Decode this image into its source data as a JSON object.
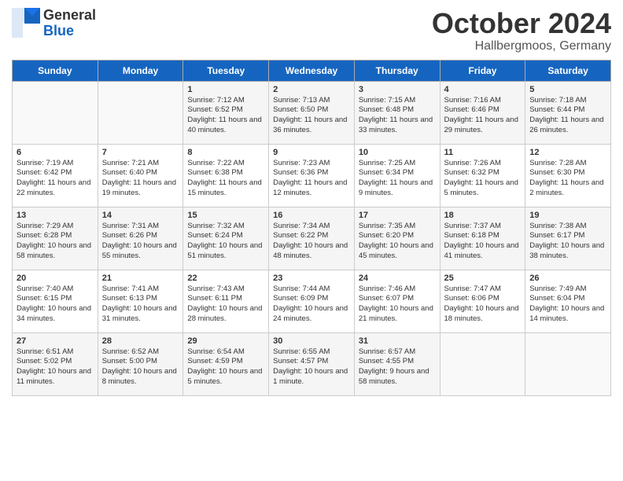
{
  "header": {
    "logo_general": "General",
    "logo_blue": "Blue",
    "month_title": "October 2024",
    "location": "Hallbergmoos, Germany"
  },
  "days_of_week": [
    "Sunday",
    "Monday",
    "Tuesday",
    "Wednesday",
    "Thursday",
    "Friday",
    "Saturday"
  ],
  "weeks": [
    [
      {
        "day": "",
        "info": ""
      },
      {
        "day": "",
        "info": ""
      },
      {
        "day": "1",
        "info": "Sunrise: 7:12 AM\nSunset: 6:52 PM\nDaylight: 11 hours and 40 minutes."
      },
      {
        "day": "2",
        "info": "Sunrise: 7:13 AM\nSunset: 6:50 PM\nDaylight: 11 hours and 36 minutes."
      },
      {
        "day": "3",
        "info": "Sunrise: 7:15 AM\nSunset: 6:48 PM\nDaylight: 11 hours and 33 minutes."
      },
      {
        "day": "4",
        "info": "Sunrise: 7:16 AM\nSunset: 6:46 PM\nDaylight: 11 hours and 29 minutes."
      },
      {
        "day": "5",
        "info": "Sunrise: 7:18 AM\nSunset: 6:44 PM\nDaylight: 11 hours and 26 minutes."
      }
    ],
    [
      {
        "day": "6",
        "info": "Sunrise: 7:19 AM\nSunset: 6:42 PM\nDaylight: 11 hours and 22 minutes."
      },
      {
        "day": "7",
        "info": "Sunrise: 7:21 AM\nSunset: 6:40 PM\nDaylight: 11 hours and 19 minutes."
      },
      {
        "day": "8",
        "info": "Sunrise: 7:22 AM\nSunset: 6:38 PM\nDaylight: 11 hours and 15 minutes."
      },
      {
        "day": "9",
        "info": "Sunrise: 7:23 AM\nSunset: 6:36 PM\nDaylight: 11 hours and 12 minutes."
      },
      {
        "day": "10",
        "info": "Sunrise: 7:25 AM\nSunset: 6:34 PM\nDaylight: 11 hours and 9 minutes."
      },
      {
        "day": "11",
        "info": "Sunrise: 7:26 AM\nSunset: 6:32 PM\nDaylight: 11 hours and 5 minutes."
      },
      {
        "day": "12",
        "info": "Sunrise: 7:28 AM\nSunset: 6:30 PM\nDaylight: 11 hours and 2 minutes."
      }
    ],
    [
      {
        "day": "13",
        "info": "Sunrise: 7:29 AM\nSunset: 6:28 PM\nDaylight: 10 hours and 58 minutes."
      },
      {
        "day": "14",
        "info": "Sunrise: 7:31 AM\nSunset: 6:26 PM\nDaylight: 10 hours and 55 minutes."
      },
      {
        "day": "15",
        "info": "Sunrise: 7:32 AM\nSunset: 6:24 PM\nDaylight: 10 hours and 51 minutes."
      },
      {
        "day": "16",
        "info": "Sunrise: 7:34 AM\nSunset: 6:22 PM\nDaylight: 10 hours and 48 minutes."
      },
      {
        "day": "17",
        "info": "Sunrise: 7:35 AM\nSunset: 6:20 PM\nDaylight: 10 hours and 45 minutes."
      },
      {
        "day": "18",
        "info": "Sunrise: 7:37 AM\nSunset: 6:18 PM\nDaylight: 10 hours and 41 minutes."
      },
      {
        "day": "19",
        "info": "Sunrise: 7:38 AM\nSunset: 6:17 PM\nDaylight: 10 hours and 38 minutes."
      }
    ],
    [
      {
        "day": "20",
        "info": "Sunrise: 7:40 AM\nSunset: 6:15 PM\nDaylight: 10 hours and 34 minutes."
      },
      {
        "day": "21",
        "info": "Sunrise: 7:41 AM\nSunset: 6:13 PM\nDaylight: 10 hours and 31 minutes."
      },
      {
        "day": "22",
        "info": "Sunrise: 7:43 AM\nSunset: 6:11 PM\nDaylight: 10 hours and 28 minutes."
      },
      {
        "day": "23",
        "info": "Sunrise: 7:44 AM\nSunset: 6:09 PM\nDaylight: 10 hours and 24 minutes."
      },
      {
        "day": "24",
        "info": "Sunrise: 7:46 AM\nSunset: 6:07 PM\nDaylight: 10 hours and 21 minutes."
      },
      {
        "day": "25",
        "info": "Sunrise: 7:47 AM\nSunset: 6:06 PM\nDaylight: 10 hours and 18 minutes."
      },
      {
        "day": "26",
        "info": "Sunrise: 7:49 AM\nSunset: 6:04 PM\nDaylight: 10 hours and 14 minutes."
      }
    ],
    [
      {
        "day": "27",
        "info": "Sunrise: 6:51 AM\nSunset: 5:02 PM\nDaylight: 10 hours and 11 minutes."
      },
      {
        "day": "28",
        "info": "Sunrise: 6:52 AM\nSunset: 5:00 PM\nDaylight: 10 hours and 8 minutes."
      },
      {
        "day": "29",
        "info": "Sunrise: 6:54 AM\nSunset: 4:59 PM\nDaylight: 10 hours and 5 minutes."
      },
      {
        "day": "30",
        "info": "Sunrise: 6:55 AM\nSunset: 4:57 PM\nDaylight: 10 hours and 1 minute."
      },
      {
        "day": "31",
        "info": "Sunrise: 6:57 AM\nSunset: 4:55 PM\nDaylight: 9 hours and 58 minutes."
      },
      {
        "day": "",
        "info": ""
      },
      {
        "day": "",
        "info": ""
      }
    ]
  ]
}
